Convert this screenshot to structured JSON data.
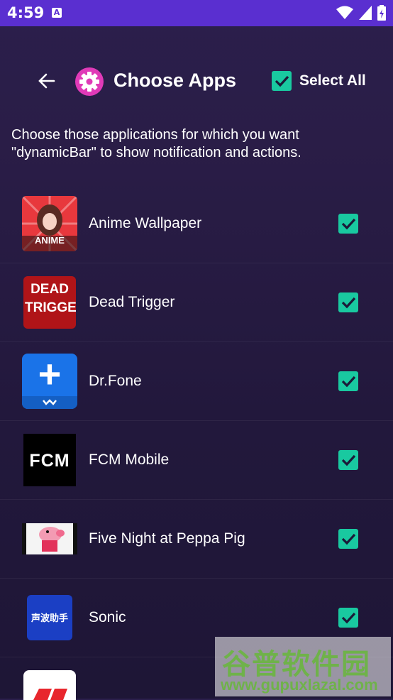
{
  "status": {
    "time": "4:59",
    "icon_a": "A"
  },
  "header": {
    "title": "Choose Apps",
    "select_all": "Select All"
  },
  "description": "Choose those applications for which you want \"dynamicBar\" to show notification and actions.",
  "apps": [
    {
      "name": "Anime Wallpaper",
      "icon_text": "ANIME"
    },
    {
      "name": "Dead Trigger",
      "icon_text": "DEAD TRIGGER"
    },
    {
      "name": "Dr.Fone",
      "icon_text": "+"
    },
    {
      "name": "FCM Mobile",
      "icon_text": "FCM"
    },
    {
      "name": "Five Night at Peppa Pig",
      "icon_text": ""
    },
    {
      "name": "Sonic",
      "icon_text": "声波助手"
    }
  ],
  "watermark": {
    "cn": "谷普软件园",
    "url": "www.gupuxlazal.com"
  },
  "colors": {
    "accent": "#19c9a0",
    "statusbar": "#5a2fd0",
    "gear": "#e03ab8"
  }
}
